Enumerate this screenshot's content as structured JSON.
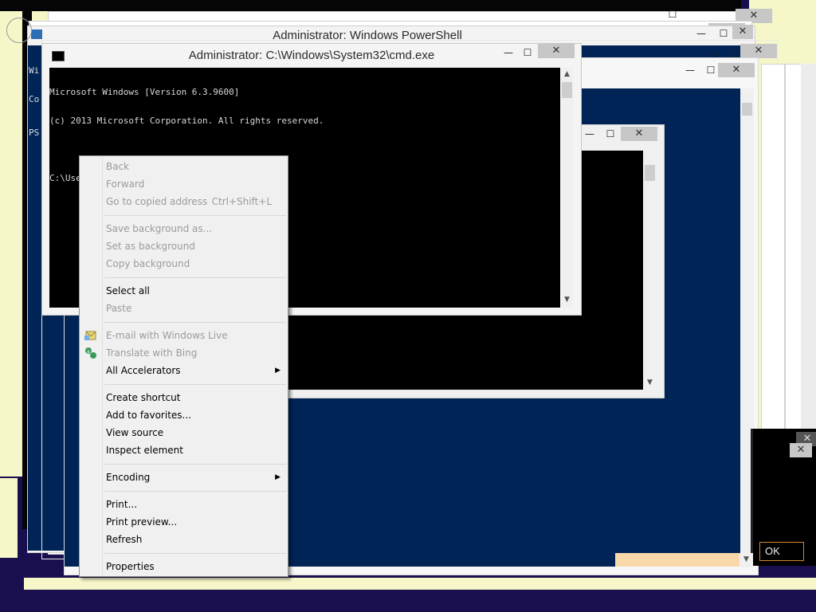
{
  "windows": {
    "powershell": {
      "title": "Administrator: Windows PowerShell",
      "console_lines": [
        "Wi",
        "Co",
        "PS"
      ]
    },
    "cmd": {
      "title": "Administrator: C:\\Windows\\System32\\cmd.exe",
      "console_lines": [
        "Microsoft Windows [Version 6.3.9600]",
        "(c) 2013 Microsoft Corporation. All rights reserved.",
        "",
        "C:\\Users\\VM4\\Downloads\\Debug(9)\\Debug>"
      ]
    },
    "dialog": {
      "ok_label": "OK"
    }
  },
  "caption_glyphs": {
    "minimize": "—",
    "maximize": "☐",
    "close": "✕"
  },
  "context_menu": {
    "items": [
      {
        "label": "Back",
        "enabled": false
      },
      {
        "label": "Forward",
        "enabled": false
      },
      {
        "label": "Go to copied address",
        "shortcut": "Ctrl+Shift+L",
        "enabled": false
      },
      {
        "label": "Save background as...",
        "enabled": false
      },
      {
        "label": "Set as background",
        "enabled": false
      },
      {
        "label": "Copy background",
        "enabled": false
      },
      {
        "label": "Select all",
        "enabled": true
      },
      {
        "label": "Paste",
        "enabled": false
      },
      {
        "label": "E-mail with Windows Live",
        "enabled": false,
        "icon": "windows-live-mail-icon"
      },
      {
        "label": "Translate with Bing",
        "enabled": false,
        "icon": "bing-translate-icon"
      },
      {
        "label": "All Accelerators",
        "enabled": true,
        "submenu": true
      },
      {
        "label": "Create shortcut",
        "enabled": true
      },
      {
        "label": "Add to favorites...",
        "enabled": true
      },
      {
        "label": "View source",
        "enabled": true
      },
      {
        "label": "Inspect element",
        "enabled": true
      },
      {
        "label": "Encoding",
        "enabled": true,
        "submenu": true
      },
      {
        "label": "Print...",
        "enabled": true
      },
      {
        "label": "Print preview...",
        "enabled": true
      },
      {
        "label": "Refresh",
        "enabled": true
      },
      {
        "label": "Properties",
        "enabled": true
      }
    ],
    "submenu_arrow": "▶"
  },
  "colors": {
    "powershell_blue": "#012456",
    "console_black": "#000000",
    "desktop_purple": "#1a0f4e",
    "menu_background": "#f0f0f0",
    "disabled_text": "#9b9b9b"
  }
}
